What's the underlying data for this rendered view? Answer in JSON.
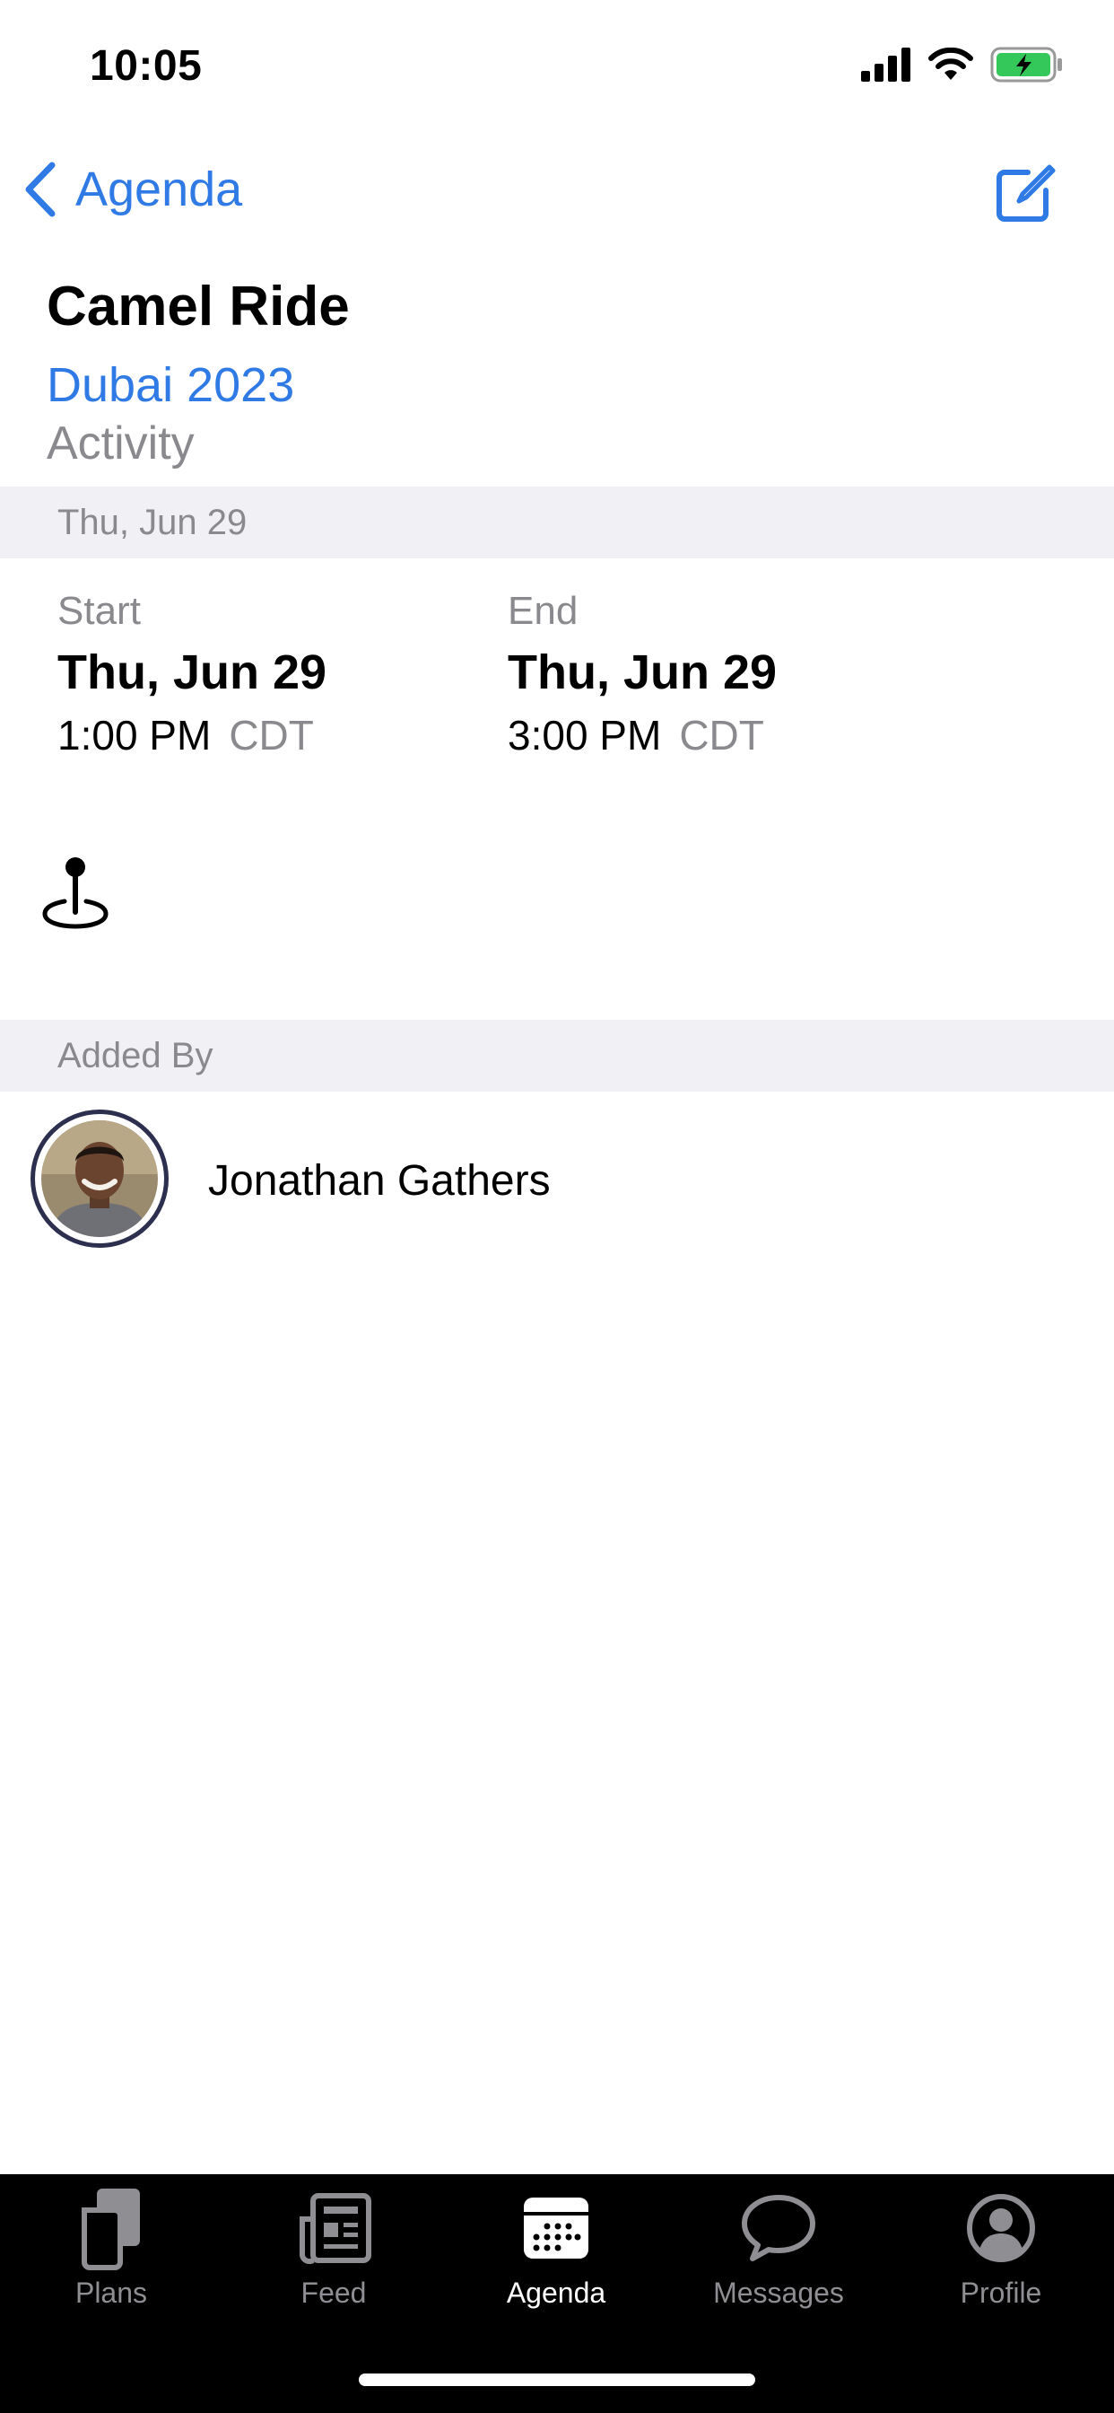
{
  "status_bar": {
    "time": "10:05"
  },
  "nav": {
    "back_label": "Agenda"
  },
  "event": {
    "title": "Camel Ride",
    "trip": "Dubai 2023",
    "type": "Activity",
    "date_header": "Thu, Jun 29",
    "start": {
      "label": "Start",
      "date": "Thu, Jun 29",
      "time": "1:00 PM",
      "tz": "CDT"
    },
    "end": {
      "label": "End",
      "date": "Thu, Jun 29",
      "time": "3:00 PM",
      "tz": "CDT"
    }
  },
  "added_by": {
    "header": "Added By",
    "name": "Jonathan Gathers"
  },
  "tabs": [
    {
      "label": "Plans",
      "icon": "plans-icon",
      "active": false
    },
    {
      "label": "Feed",
      "icon": "feed-icon",
      "active": false
    },
    {
      "label": "Agenda",
      "icon": "agenda-icon",
      "active": true
    },
    {
      "label": "Messages",
      "icon": "messages-icon",
      "active": false
    },
    {
      "label": "Profile",
      "icon": "profile-icon",
      "active": false
    }
  ],
  "colors": {
    "accent": "#2f7ae5",
    "secondary_text": "#8a8a8e",
    "section_bg": "#f0f0f5",
    "battery": "#34c759"
  }
}
